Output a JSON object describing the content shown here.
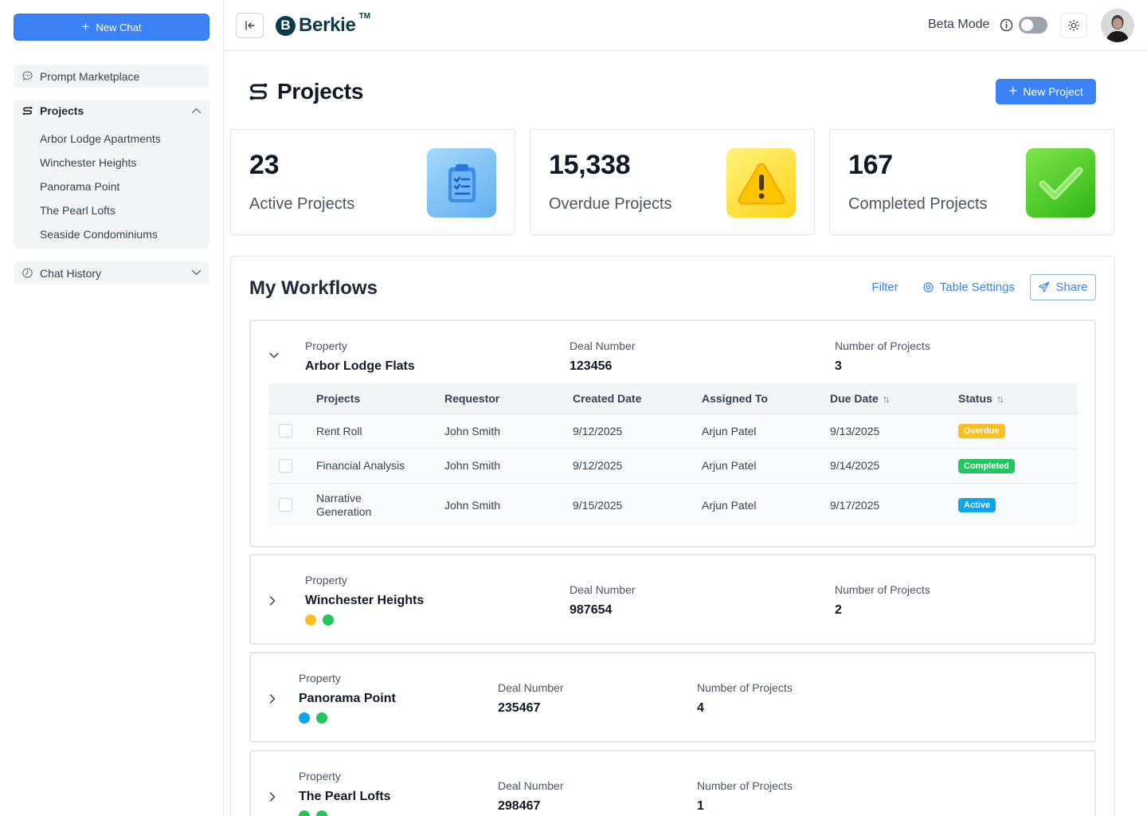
{
  "sidebar": {
    "new_chat_label": "New Chat",
    "prompt_marketplace_label": "Prompt Marketplace",
    "projects_label": "Projects",
    "project_items": [
      "Arbor Lodge Apartments",
      "Winchester Heights",
      "Panorama Point",
      "The Pearl Lofts",
      "Seaside Condominiums"
    ],
    "chat_history_label": "Chat History"
  },
  "header": {
    "logo_text": "Berkie",
    "logo_letter": "B",
    "logo_tm": "TM",
    "beta_mode_label": "Beta Mode",
    "beta_mode_on": false
  },
  "page": {
    "title": "Projects",
    "new_project_label": "New Project"
  },
  "stats": [
    {
      "value": "23",
      "label": "Active Projects",
      "icon": "clipboard-icon"
    },
    {
      "value": "15,338",
      "label": "Overdue Projects",
      "icon": "warning-icon"
    },
    {
      "value": "167",
      "label": "Completed Projects",
      "icon": "check-icon"
    }
  ],
  "workflows": {
    "title": "My Workflows",
    "filter_label": "Filter",
    "table_settings_label": "Table Settings",
    "share_label": "Share",
    "field_labels": {
      "property": "Property",
      "deal_number": "Deal Number",
      "num_projects": "Number of Projects"
    },
    "columns": [
      "Projects",
      "Requestor",
      "Created Date",
      "Assigned To",
      "Due Date",
      "Status"
    ],
    "groups": [
      {
        "property": "Arbor Lodge Flats",
        "deal_number": "123456",
        "num_projects": "3",
        "expanded": true,
        "rows": [
          {
            "project": "Rent Roll",
            "requestor": "John Smith",
            "created": "9/12/2025",
            "assigned": "Arjun Patel",
            "due": "9/13/2025",
            "status": "Overdue"
          },
          {
            "project": "Financial Analysis",
            "requestor": "John Smith",
            "created": "9/12/2025",
            "assigned": "Arjun Patel",
            "due": "9/14/2025",
            "status": "Completed"
          },
          {
            "project": "Narrative Generation",
            "requestor": "John Smith",
            "created": "9/15/2025",
            "assigned": "Arjun Patel",
            "due": "9/17/2025",
            "status": "Active"
          }
        ]
      },
      {
        "property": "Winchester Heights",
        "deal_number": "987654",
        "num_projects": "2",
        "expanded": false,
        "status_dots": [
          "#fbbf24",
          "#22c55e"
        ]
      },
      {
        "property": "Panorama Point",
        "deal_number": "235467",
        "num_projects": "4",
        "expanded": false,
        "status_dots": [
          "#0ea5e9",
          "#22c55e"
        ]
      },
      {
        "property": "The Pearl Lofts",
        "deal_number": "298467",
        "num_projects": "1",
        "expanded": false,
        "status_dots": [
          "#22c55e",
          "#22c55e"
        ]
      }
    ]
  },
  "colors": {
    "accent": "#3b82f6",
    "brand": "#0b3b4a",
    "overdue": "#fbbf24",
    "completed": "#22c55e",
    "active": "#0ea5e9"
  }
}
